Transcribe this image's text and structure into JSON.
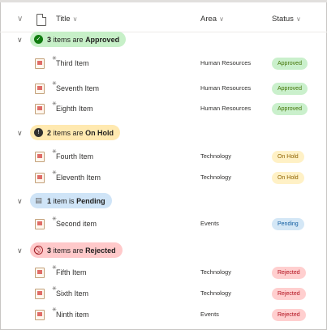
{
  "header": {
    "title_label": "Title",
    "area_label": "Area",
    "status_label": "Status",
    "caret": "∨"
  },
  "groups": [
    {
      "count": "3",
      "text": "items are",
      "status": "Approved",
      "icon": "check-circle-icon",
      "color": "#c7f0c8",
      "items": [
        {
          "title": "Third Item",
          "area": "Human Resources",
          "status": "Approved"
        },
        {
          "title": "Seventh Item",
          "area": "Human Resources",
          "status": "Approved"
        },
        {
          "title": "Eighth Item",
          "area": "Human Resources",
          "status": "Approved"
        }
      ]
    },
    {
      "count": "2",
      "text": "items are",
      "status": "On Hold",
      "icon": "exclamation-circle-icon",
      "color": "#ffe9b0",
      "items": [
        {
          "title": "Fourth Item",
          "area": "Technology",
          "status": "On Hold"
        },
        {
          "title": "Eleventh Item",
          "area": "Technology",
          "status": "On Hold"
        }
      ]
    },
    {
      "count": "1",
      "text": "item is",
      "status": "Pending",
      "icon": "clipboard-icon",
      "color": "#cfe4f7",
      "items": [
        {
          "title": "Second item",
          "area": "Events",
          "status": "Pending"
        }
      ]
    },
    {
      "count": "3",
      "text": "items are",
      "status": "Rejected",
      "icon": "blocked-icon",
      "color": "#ffc9ca",
      "items": [
        {
          "title": "Fifth Item",
          "area": "Technology",
          "status": "Rejected"
        },
        {
          "title": "Sixth Item",
          "area": "Technology",
          "status": "Rejected"
        },
        {
          "title": "Ninth item",
          "area": "Events",
          "status": "Rejected"
        }
      ]
    }
  ]
}
